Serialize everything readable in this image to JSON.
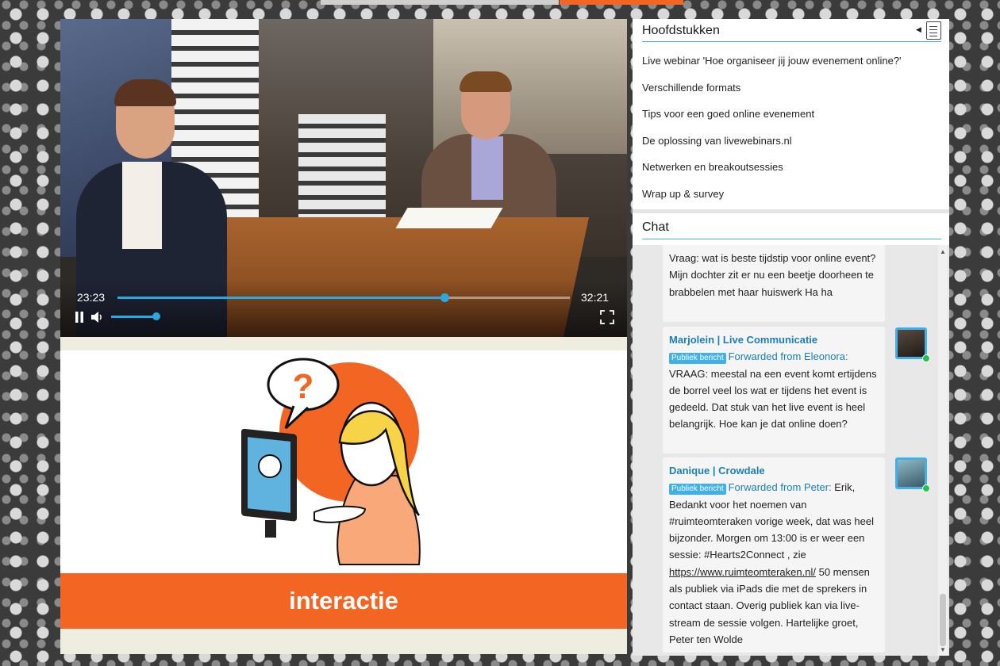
{
  "player": {
    "current_time": "23:23",
    "duration": "32:21",
    "progress_fraction": 0.723,
    "volume_fraction": 0.9,
    "colors": {
      "accent": "#2aa8e0"
    }
  },
  "slide": {
    "banner_text": "interactie",
    "question_mark": "?",
    "colors": {
      "banner": "#f26522"
    }
  },
  "chapters": {
    "title": "Hoofdstukken",
    "items": [
      "Live webinar 'Hoe organiseer jij jouw evenement online?'",
      "Verschillende formats",
      "Tips voor een goed online evenement",
      "De oplossing van livewebinars.nl",
      "Netwerken en breakoutsessies",
      "Wrap up & survey"
    ]
  },
  "chat": {
    "title": "Chat",
    "messages": [
      {
        "text": "Vraag: wat is beste tijdstip voor online event? Mijn dochter zit er nu een beetje doorheen te brabbelen met haar huiswerk Ha ha"
      },
      {
        "author": "Marjolein | Live Communicatie",
        "badge": "Publiek bericht",
        "forwarded": "Forwarded from Eleonora:",
        "text": "VRAAG: meestal na een event komt ertijdens de borrel veel los wat er tijdens het event is gedeeld. Dat stuk van het live event is heel belangrijk. Hoe kan je dat online doen?"
      },
      {
        "author": "Danique | Crowdale",
        "badge": "Publiek bericht",
        "forwarded": "Forwarded from Peter:",
        "text_before_link": "Erik, Bedankt voor het noemen van #ruimteomteraken vorige week, dat was heel bijzonder. Morgen om 13:00 is er weer een sessie: #Hearts2Connect , zie",
        "link": "https://www.ruimteomteraken.nl/",
        "text_after_link": "50 mensen als publiek via iPads die met de sprekers in contact staan. Overig publiek kan via live-stream de sessie volgen. Hartelijke groet, Peter ten Wolde"
      }
    ]
  },
  "icons": {
    "play_pause": "pause-icon",
    "volume": "volume-icon",
    "fullscreen": "fullscreen-icon",
    "chapters_toc": "table-of-contents-icon",
    "collapse": "chevron-left-icon"
  }
}
